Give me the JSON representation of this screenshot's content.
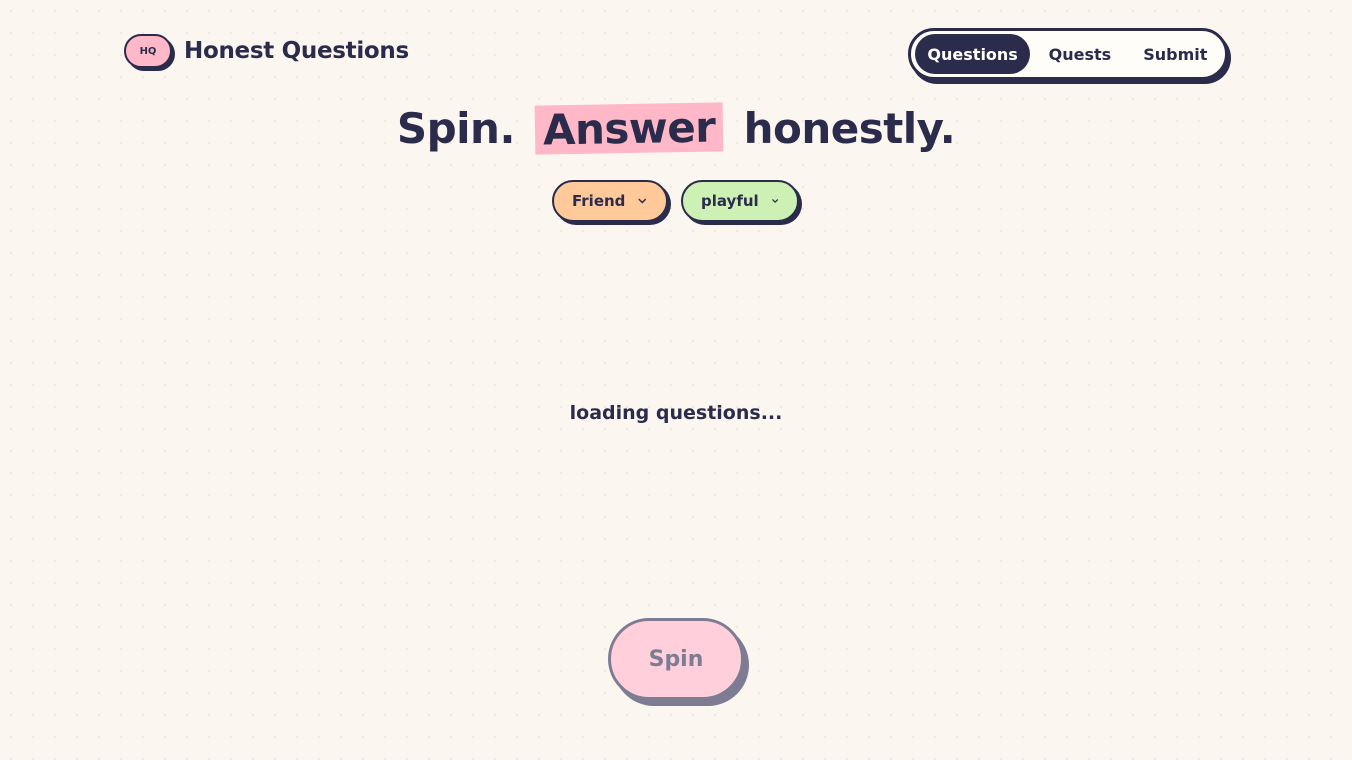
{
  "brand": {
    "logo_text": "HQ",
    "name": "Honest Questions"
  },
  "nav": {
    "items": [
      {
        "label": "Questions",
        "active": true
      },
      {
        "label": "Quests",
        "active": false
      },
      {
        "label": "Submit",
        "active": false
      }
    ]
  },
  "hero": {
    "part1": "Spin.",
    "highlight": "Answer",
    "part2": "honestly."
  },
  "filters": {
    "relationship": {
      "value": "Friend",
      "icon": "chevron-down-icon"
    },
    "mood": {
      "value": "playful",
      "icon": "chevron-down-icon"
    }
  },
  "status": {
    "loading_text": "loading questions..."
  },
  "actions": {
    "spin_label": "Spin"
  },
  "colors": {
    "background": "#fbf6f0",
    "ink": "#2b2b4b",
    "pink": "#ffb8c8",
    "orange": "#ffc99a",
    "green": "#cdf0b4",
    "spin_disabled": "#ffd0dc"
  }
}
